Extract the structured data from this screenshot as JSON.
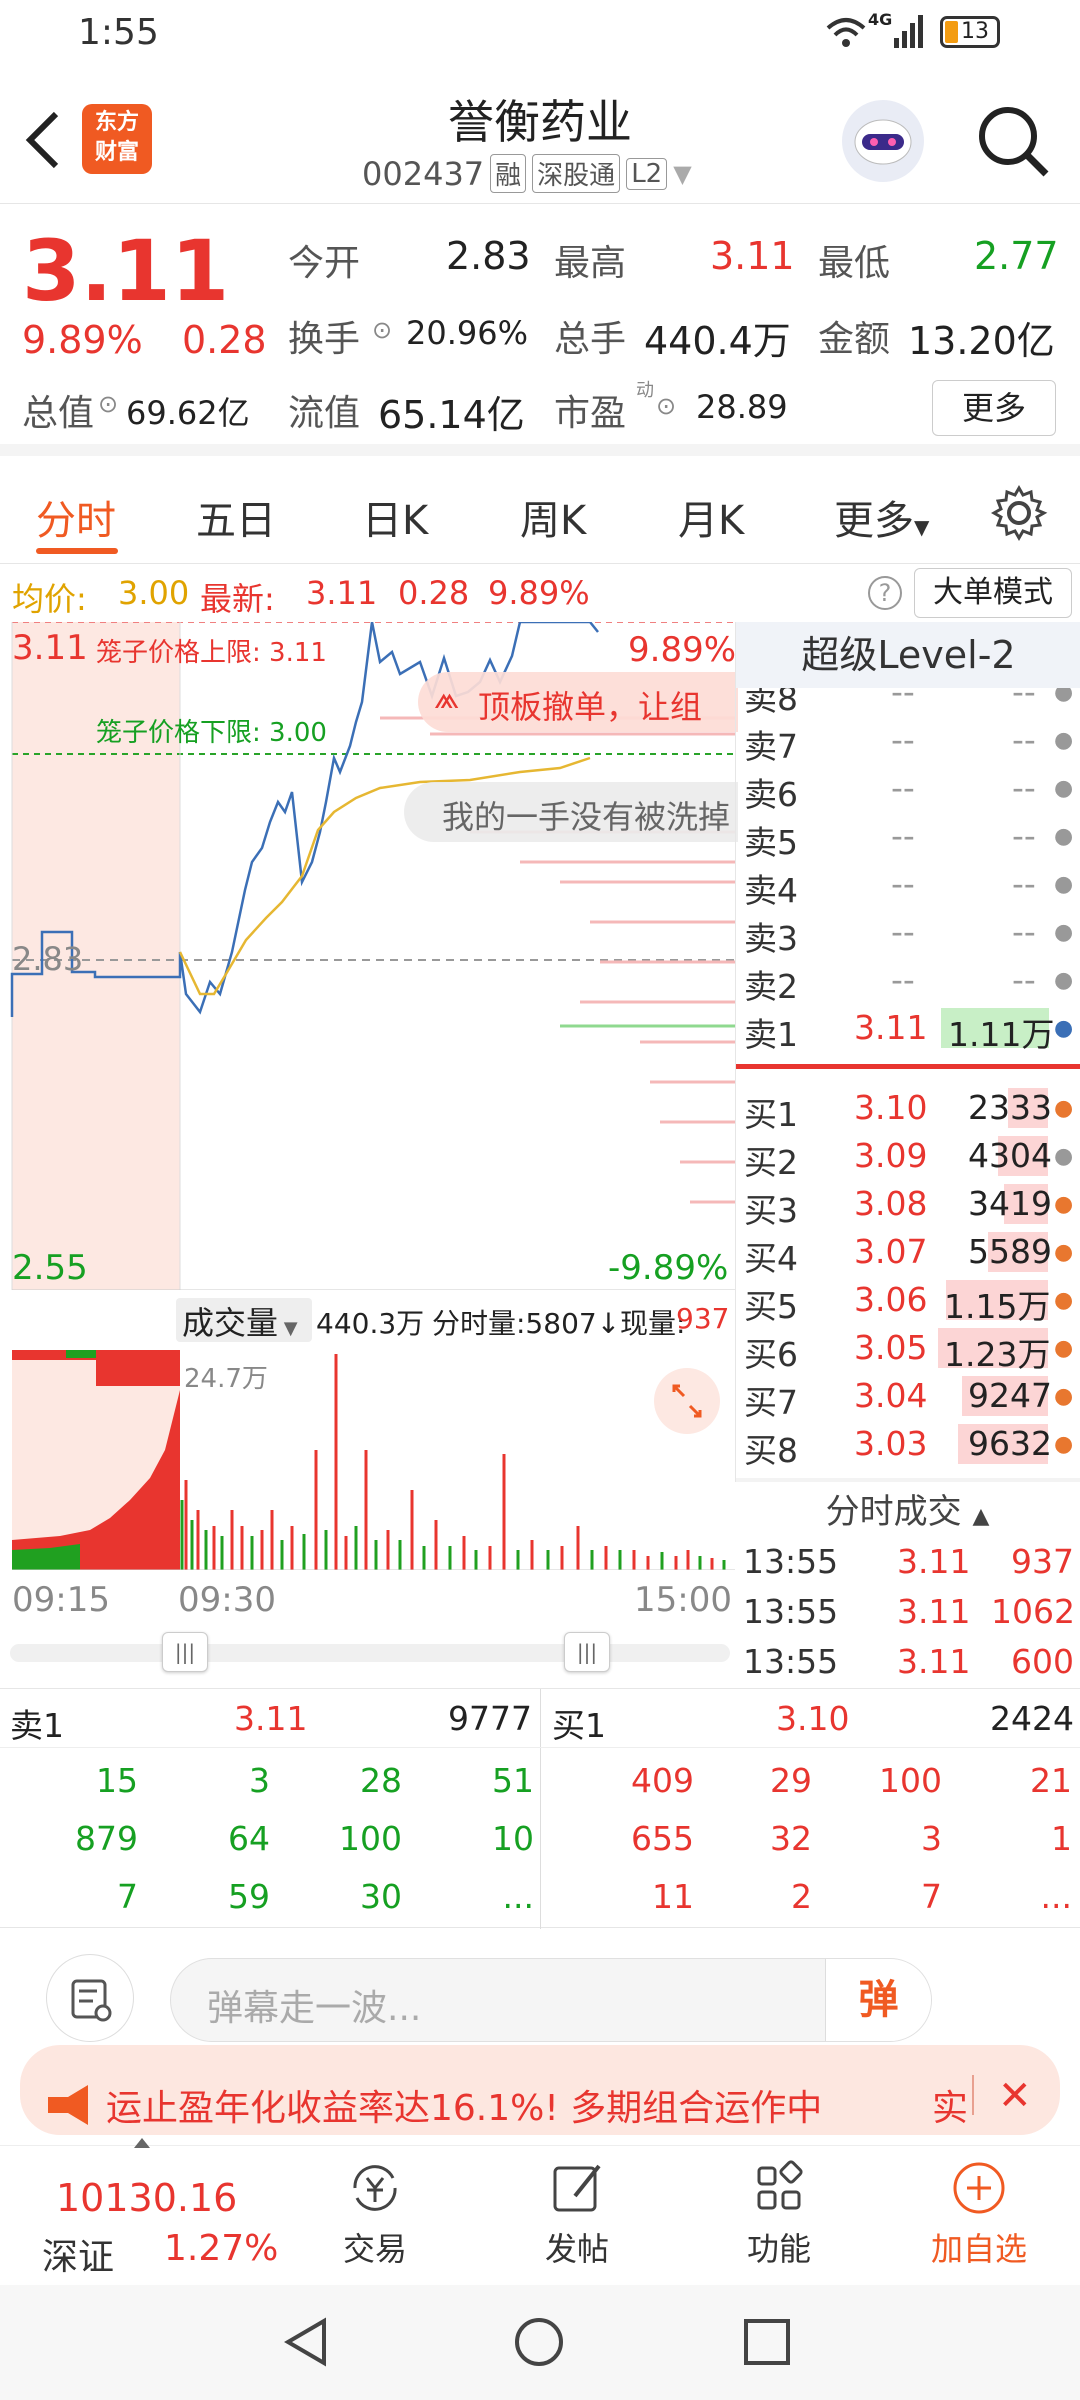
{
  "status": {
    "time": "1:55",
    "network": "4G",
    "battery": "13"
  },
  "header": {
    "logo_line1": "东方",
    "logo_line2": "财富",
    "stock_name": "誉衡药业",
    "stock_code": "002437",
    "tags": [
      "融",
      "深股通",
      "L2"
    ]
  },
  "quote": {
    "price": "3.11",
    "change_pct": "9.89%",
    "change_amt": "0.28",
    "open_label": "今开",
    "open": "2.83",
    "high_label": "最高",
    "high": "3.11",
    "low_label": "最低",
    "low": "2.77",
    "turnover_label": "换手",
    "turnover": "20.96%",
    "volume_label": "总手",
    "volume": "440.4万",
    "amount_label": "金额",
    "amount": "13.20亿",
    "mktcap_label": "总值",
    "mktcap": "69.62亿",
    "float_label": "流值",
    "float": "65.14亿",
    "pe_label": "市盈",
    "pe_sup": "动",
    "pe": "28.89",
    "more_button": "更多"
  },
  "tabs": [
    "分时",
    "五日",
    "日K",
    "周K",
    "月K",
    "更多"
  ],
  "infobar": {
    "avg_label": "均价:",
    "avg": "3.00",
    "latest_label": "最新:",
    "latest": "3.11",
    "chg": "0.28",
    "pct": "9.89%",
    "bigorder_button": "大单模式"
  },
  "chart": {
    "top_price": "3.11",
    "upper_limit_label": "笼子价格上限: 3.11",
    "lower_limit_label": "笼子价格下限: 3.00",
    "top_pct": "9.89%",
    "mid_price": "2.83",
    "bottom_price": "2.55",
    "bottom_pct": "-9.89%",
    "banner1": "顶板撤单，让组",
    "banner2": "我的一手没有被洗掉"
  },
  "level2": {
    "title": "超级Level-2",
    "sells": [
      {
        "label": "卖8",
        "price": "--",
        "vol": "--"
      },
      {
        "label": "卖7",
        "price": "--",
        "vol": "--"
      },
      {
        "label": "卖6",
        "price": "--",
        "vol": "--"
      },
      {
        "label": "卖5",
        "price": "--",
        "vol": "--"
      },
      {
        "label": "卖4",
        "price": "--",
        "vol": "--"
      },
      {
        "label": "卖3",
        "price": "--",
        "vol": "--"
      },
      {
        "label": "卖2",
        "price": "--",
        "vol": "--"
      },
      {
        "label": "卖1",
        "price": "3.11",
        "vol": "1.11万"
      }
    ],
    "buys": [
      {
        "label": "买1",
        "price": "3.10",
        "vol": "2333"
      },
      {
        "label": "买2",
        "price": "3.09",
        "vol": "4304"
      },
      {
        "label": "买3",
        "price": "3.08",
        "vol": "3419"
      },
      {
        "label": "买4",
        "price": "3.07",
        "vol": "5589"
      },
      {
        "label": "买5",
        "price": "3.06",
        "vol": "1.15万"
      },
      {
        "label": "买6",
        "price": "3.05",
        "vol": "1.23万"
      },
      {
        "label": "买7",
        "price": "3.04",
        "vol": "9247"
      },
      {
        "label": "买8",
        "price": "3.03",
        "vol": "9632"
      }
    ],
    "ticks_title": "分时成交",
    "ticks": [
      {
        "time": "13:55",
        "price": "3.11",
        "vol": "937"
      },
      {
        "time": "13:55",
        "price": "3.11",
        "vol": "1062"
      },
      {
        "time": "13:55",
        "price": "3.11",
        "vol": "600"
      }
    ]
  },
  "volume": {
    "selector": "成交量",
    "total": "440.3万",
    "minute_label": "分时量:5807↓",
    "now_label": "现量:",
    "now": "937",
    "max_label": "24.7万"
  },
  "timeaxis": {
    "start": "09:15",
    "open": "09:30",
    "end": "15:00"
  },
  "orderbook": {
    "sell_label": "卖1",
    "sell_price": "3.11",
    "sell_vol": "9777",
    "buy_label": "买1",
    "buy_price": "3.10",
    "buy_vol": "2424",
    "sell_queue": [
      [
        "15",
        "3",
        "28",
        "51"
      ],
      [
        "879",
        "64",
        "100",
        "10"
      ],
      [
        "7",
        "59",
        "30",
        "..."
      ]
    ],
    "buy_queue": [
      [
        "409",
        "29",
        "100",
        "21"
      ],
      [
        "655",
        "32",
        "3",
        "1"
      ],
      [
        "11",
        "2",
        "7",
        "..."
      ]
    ]
  },
  "danmu": {
    "placeholder": "弹幕走一波...",
    "send": "弹"
  },
  "promo": {
    "text": "年化收益率达16.1%! 多期组合运作中",
    "left_text": "运止盈",
    "cta": "实"
  },
  "bottomnav": {
    "index_value": "10130.16",
    "index_name": "深证",
    "index_pct": "1.27%",
    "items": [
      "交易",
      "发帖",
      "功能",
      "加自选"
    ]
  }
}
